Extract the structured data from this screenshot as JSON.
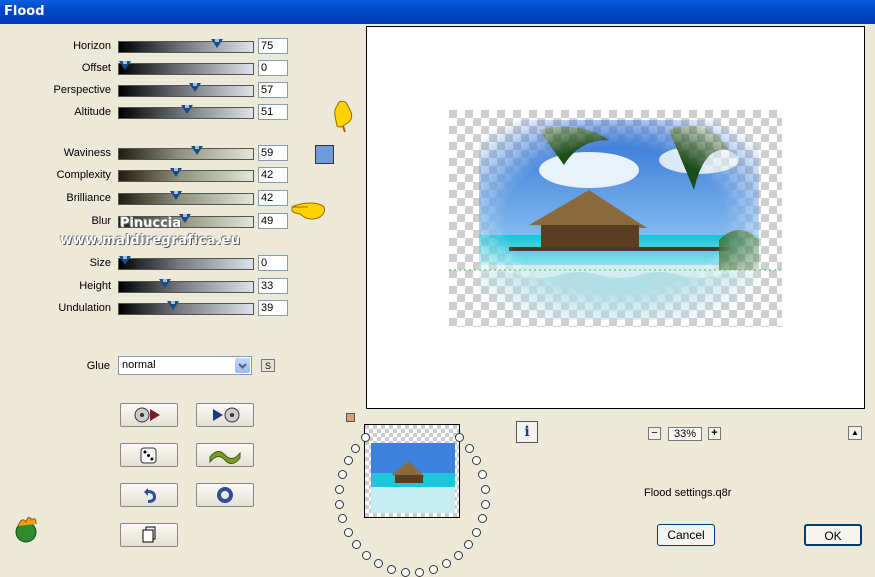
{
  "window": {
    "title": "Flood"
  },
  "sliders": [
    {
      "label": "Horizon",
      "value": "75",
      "level": 0.75
    },
    {
      "label": "Offset",
      "value": "0",
      "level": 0.0
    },
    {
      "label": "Perspective",
      "value": "57",
      "level": 0.57
    },
    {
      "label": "Altitude",
      "value": "51",
      "level": 0.51
    },
    {
      "label": "Waviness",
      "value": "59",
      "level": 0.59
    },
    {
      "label": "Complexity",
      "value": "42",
      "level": 0.42
    },
    {
      "label": "Brilliance",
      "value": "42",
      "level": 0.42
    },
    {
      "label": "Blur",
      "value": "49",
      "level": 0.49
    },
    {
      "label": "Size",
      "value": "0",
      "level": 0.0
    },
    {
      "label": "Height",
      "value": "33",
      "level": 0.33
    },
    {
      "label": "Undulation",
      "value": "39",
      "level": 0.39
    }
  ],
  "watermark": {
    "line1": "Pinuccia",
    "line2": "www.maldiregrafica.eu"
  },
  "glue": {
    "label": "Glue",
    "value": "normal",
    "s_button": "S"
  },
  "color_swatch": "#6f9bdb",
  "zoom": {
    "value": "33%",
    "minus": "−",
    "plus": "+"
  },
  "settings_file": "Flood settings.q8r",
  "buttons": {
    "cancel": "Cancel",
    "ok": "OK",
    "info": "i",
    "collapse": "▲"
  },
  "icons": [
    "rewind-icon",
    "forward-icon",
    "dice-icon",
    "wave-icon",
    "undo-icon",
    "reset-circle-icon",
    "copy-icon",
    "app-logo-icon"
  ]
}
